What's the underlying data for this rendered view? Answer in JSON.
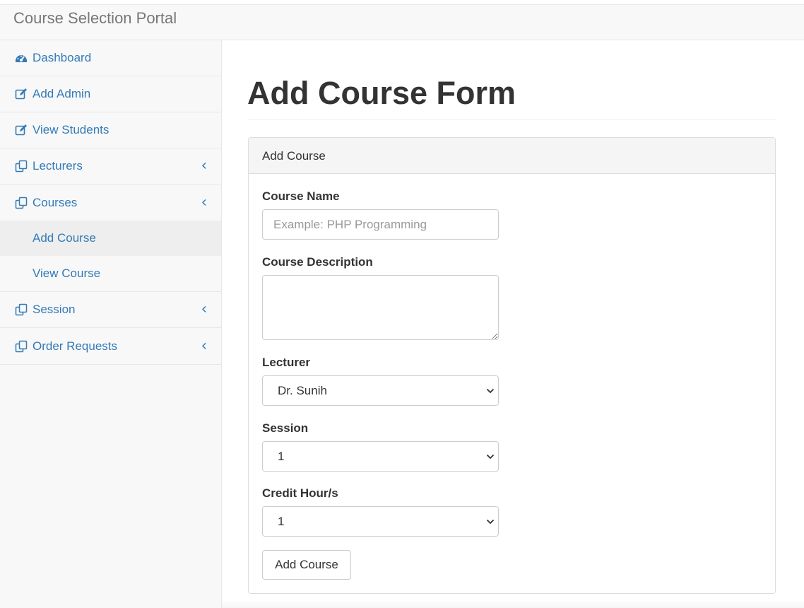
{
  "app": {
    "brand": "Course Selection Portal"
  },
  "sidebar": {
    "items": [
      {
        "label": "Dashboard",
        "icon": "dashboard-icon"
      },
      {
        "label": "Add Admin",
        "icon": "edit-icon"
      },
      {
        "label": "View Students",
        "icon": "edit-icon"
      },
      {
        "label": "Lecturers",
        "icon": "copy-icon",
        "expandable": true
      },
      {
        "label": "Courses",
        "icon": "copy-icon",
        "expandable": true,
        "children": [
          {
            "label": "Add Course",
            "active": true
          },
          {
            "label": "View Course"
          }
        ]
      },
      {
        "label": "Session",
        "icon": "copy-icon",
        "expandable": true
      },
      {
        "label": "Order Requests",
        "icon": "copy-icon",
        "expandable": true
      }
    ]
  },
  "main": {
    "title": "Add Course Form",
    "panel": {
      "heading": "Add Course",
      "fields": {
        "course_name": {
          "label": "Course Name",
          "placeholder": "Example: PHP Programming",
          "value": ""
        },
        "course_description": {
          "label": "Course Description",
          "value": ""
        },
        "lecturer": {
          "label": "Lecturer",
          "selected": "Dr. Sunih"
        },
        "session": {
          "label": "Session",
          "selected": "1"
        },
        "credit_hours": {
          "label": "Credit Hour/s",
          "selected": "1"
        }
      },
      "submit_label": "Add Course"
    }
  },
  "colors": {
    "link": "#337ab7",
    "sidebar_bg": "#f8f8f8",
    "active_bg": "#eeeeee",
    "border": "#dddddd"
  }
}
